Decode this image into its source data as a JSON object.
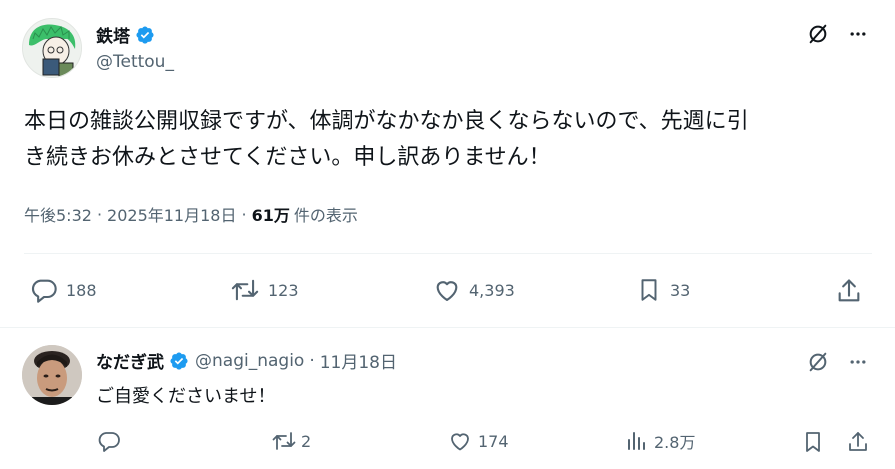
{
  "main_tweet": {
    "author_name": "鉄塔",
    "author_handle": "@Tettou_",
    "text_line1": "本日の雑談公開収録ですが、体調がなかなか良くならないので、先週に引",
    "text_line2": "き続きお休みとさせてください。申し訳ありません！",
    "time": "午後5:32",
    "date": "2025年11月18日",
    "dot": "·",
    "views_count": "61万",
    "views_label": "件の表示",
    "stats": {
      "replies": "188",
      "reposts": "123",
      "likes": "4,393",
      "bookmarks": "33"
    }
  },
  "reply": {
    "author_name": "なだぎ武",
    "author_handle": "@nagi_nagio",
    "dot": "·",
    "date": "11月18日",
    "text": "ご自愛くださいませ！",
    "stats": {
      "reposts": "2",
      "likes": "174",
      "views": "2.8万"
    }
  },
  "colors": {
    "verified": "#1d9bf0",
    "text": "#0f1419",
    "muted": "#536471",
    "divider": "#eff3f4"
  }
}
